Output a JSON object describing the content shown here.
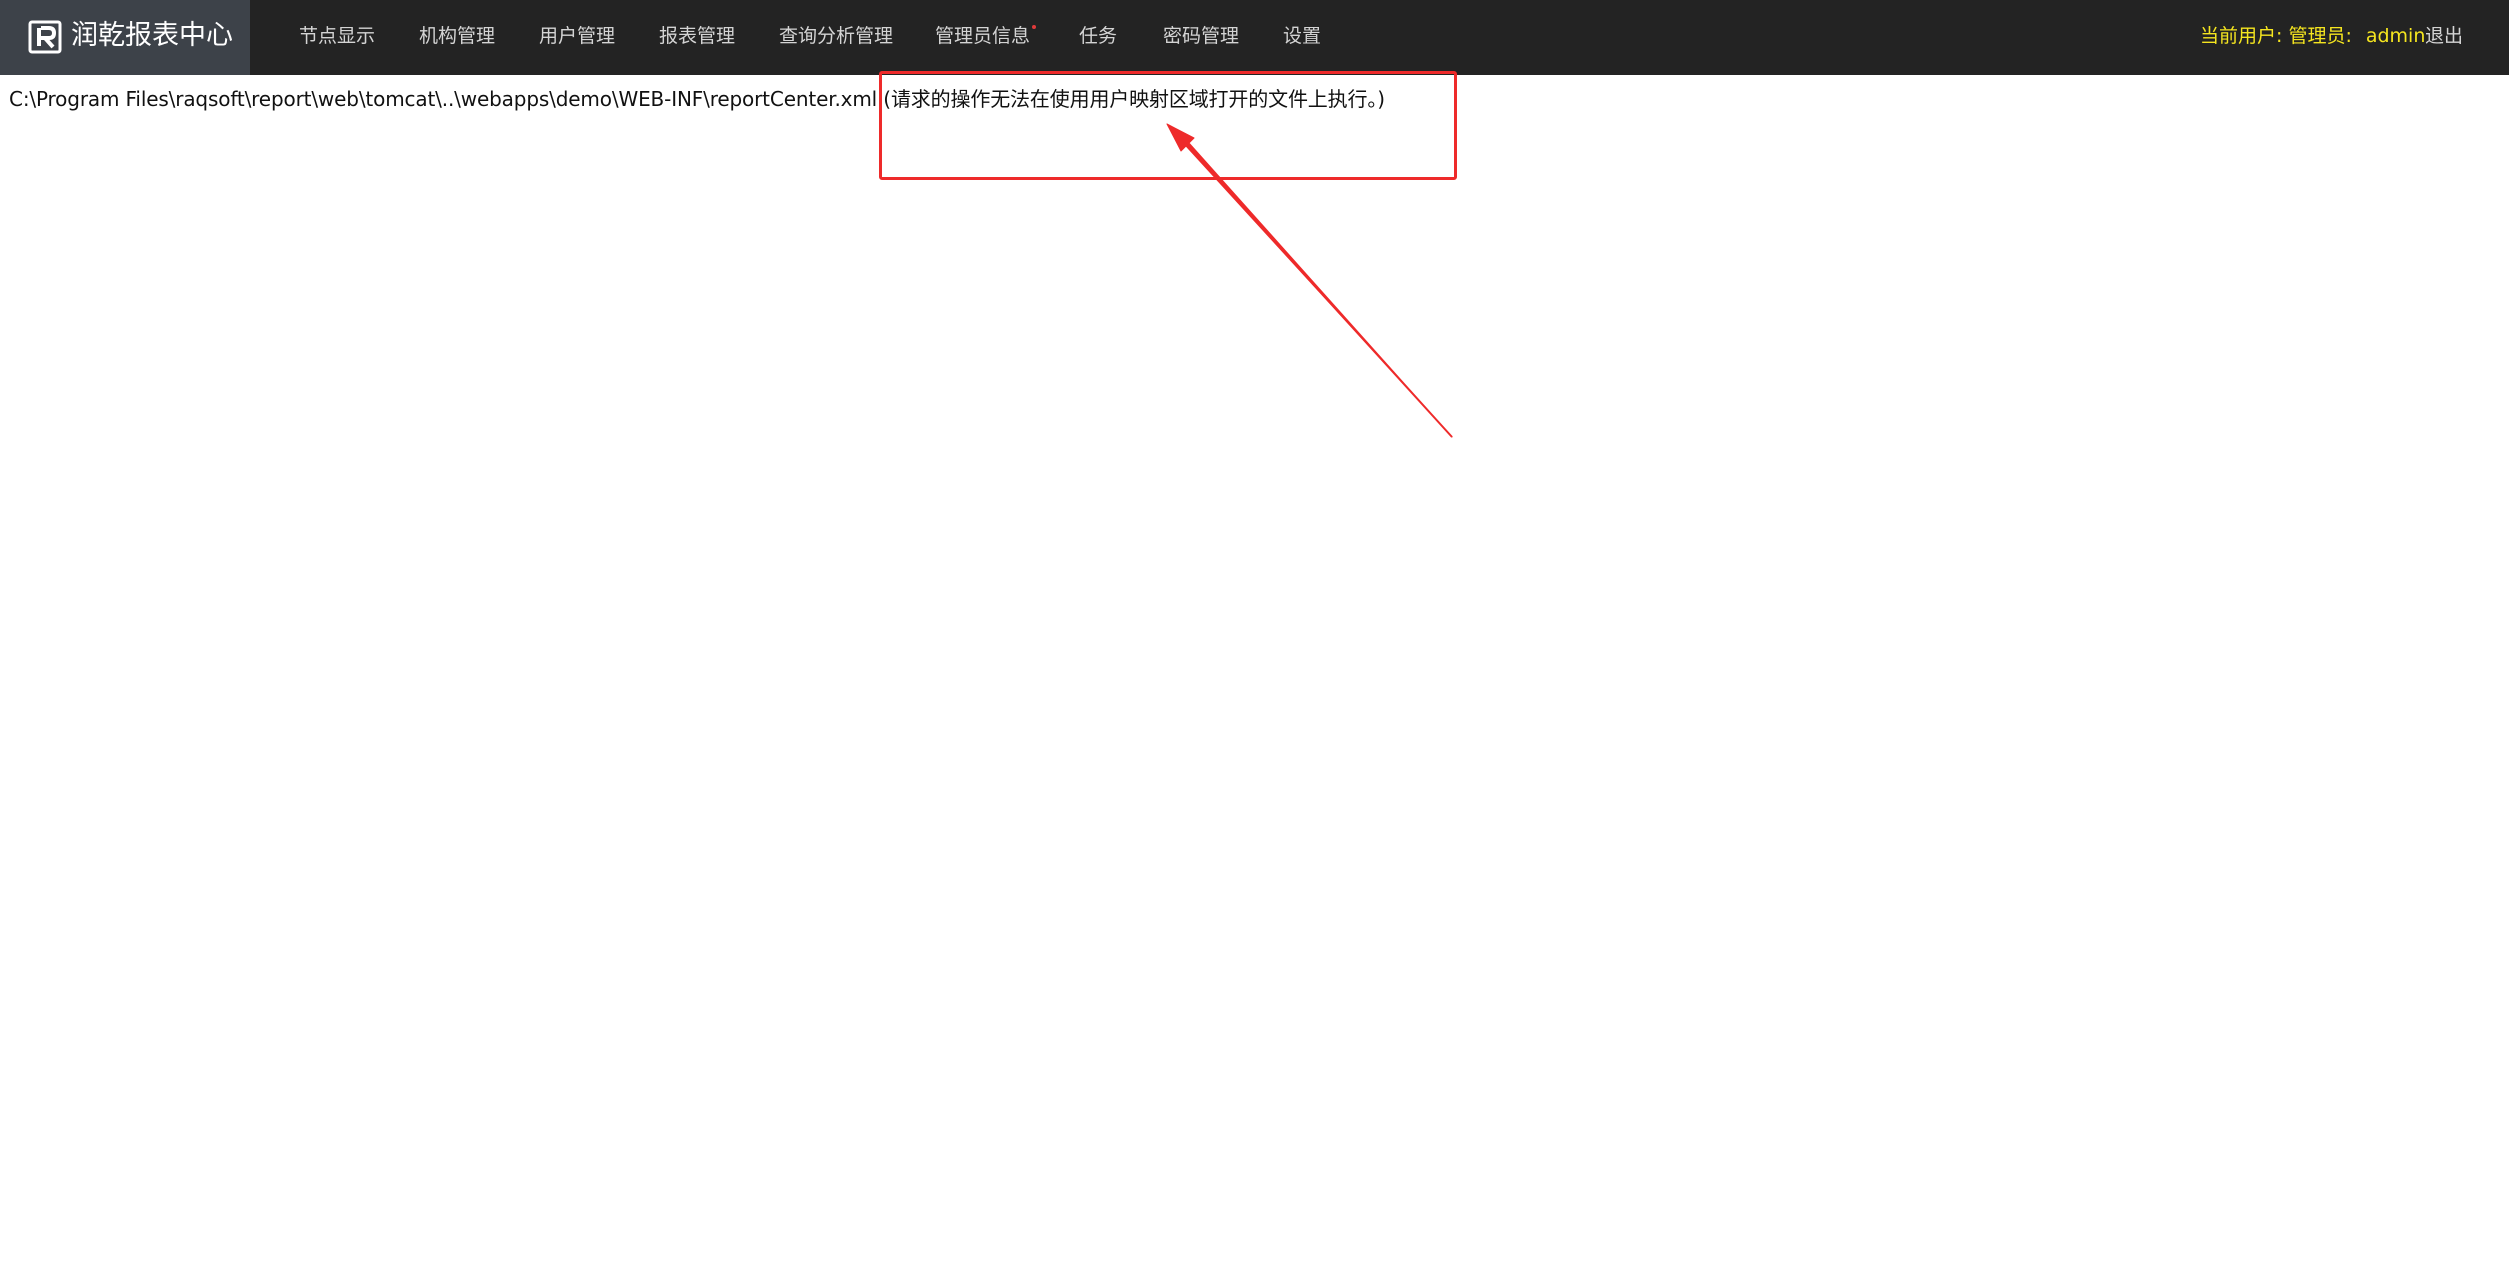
{
  "header": {
    "brand_title": "润乾报表中心",
    "nav_items": [
      {
        "label": "节点显示"
      },
      {
        "label": "机构管理"
      },
      {
        "label": "用户管理"
      },
      {
        "label": "报表管理"
      },
      {
        "label": "查询分析管理"
      },
      {
        "label": "管理员信息",
        "has_dot": true
      },
      {
        "label": "任务"
      },
      {
        "label": "密码管理"
      },
      {
        "label": "设置"
      }
    ],
    "current_user_label": "当前用户: 管理员:",
    "current_user_name": "admin",
    "logout_label": "退出"
  },
  "main": {
    "error_message": "C:\\Program Files\\raqsoft\\report\\web\\tomcat\\..\\webapps\\demo\\WEB-INF\\reportCenter.xml (请求的操作无法在使用用户映射区域打开的文件上执行。)"
  },
  "colors": {
    "topbar_bg": "#232323",
    "brand_bg": "#3d4249",
    "user_highlight": "#f5e51f",
    "annotation_red": "#ee2a2a"
  }
}
